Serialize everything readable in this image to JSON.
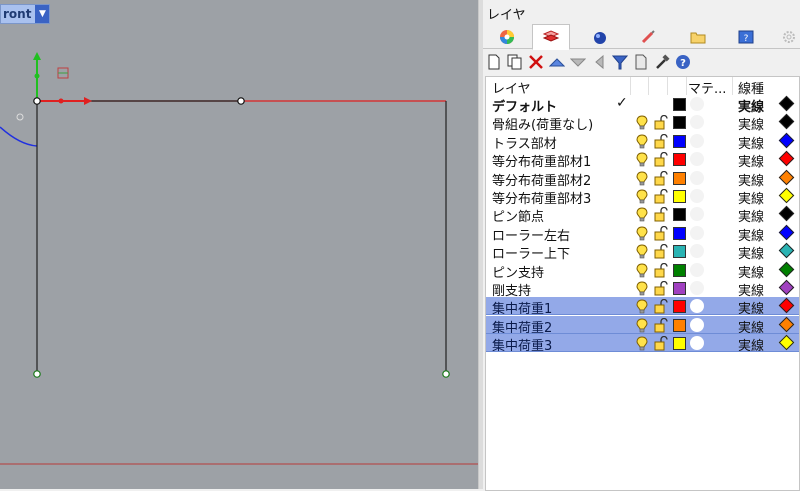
{
  "viewport": {
    "name": "ront",
    "dropdown_glyph": "▼"
  },
  "panel": {
    "title": "レイヤ",
    "tabs": [
      {
        "icon": "color-wheel-icon"
      },
      {
        "icon": "layers-icon",
        "active": true
      },
      {
        "icon": "render-sphere-icon"
      },
      {
        "icon": "brush-icon"
      },
      {
        "icon": "folder-icon"
      },
      {
        "icon": "help-window-icon"
      },
      {
        "icon": "gear-icon"
      }
    ],
    "toolbar": [
      {
        "icon": "new-layer-icon"
      },
      {
        "icon": "new-sublayer-icon"
      },
      {
        "icon": "delete-icon"
      },
      {
        "icon": "move-up-icon"
      },
      {
        "icon": "move-down-icon"
      },
      {
        "icon": "move-left-icon"
      },
      {
        "icon": "filter-icon"
      },
      {
        "icon": "document-icon"
      },
      {
        "icon": "tools-icon"
      },
      {
        "icon": "help-icon"
      }
    ]
  },
  "columns": {
    "layer": "レイヤ",
    "material": "マテ...",
    "linetype": "線種"
  },
  "layers": [
    {
      "name": "デフォルト",
      "current": true,
      "color": "#000000",
      "linetype": "実線",
      "bold": true
    },
    {
      "name": "骨組み(荷重なし)",
      "color": "#000000",
      "linetype": "実線"
    },
    {
      "name": "トラス部材",
      "color": "#0000ff",
      "linetype": "実線"
    },
    {
      "name": "等分布荷重部材1",
      "color": "#ff0000",
      "linetype": "実線"
    },
    {
      "name": "等分布荷重部材2",
      "color": "#ff8000",
      "linetype": "実線"
    },
    {
      "name": "等分布荷重部材3",
      "color": "#ffff00",
      "linetype": "実線"
    },
    {
      "name": "ピン節点",
      "color": "#000000",
      "linetype": "実線"
    },
    {
      "name": "ローラー左右",
      "color": "#0000ff",
      "linetype": "実線"
    },
    {
      "name": "ローラー上下",
      "color": "#2ab3b3",
      "linetype": "実線"
    },
    {
      "name": "ピン支持",
      "color": "#008000",
      "linetype": "実線"
    },
    {
      "name": "剛支持",
      "color": "#a040c0",
      "linetype": "実線"
    },
    {
      "name": "集中荷重1",
      "color": "#ff0000",
      "linetype": "実線",
      "selected": true
    },
    {
      "name": "集中荷重2",
      "color": "#ff8000",
      "linetype": "実線",
      "selected": true
    },
    {
      "name": "集中荷重3",
      "color": "#ffff00",
      "linetype": "実線",
      "selected": true
    }
  ],
  "icons": {
    "check": "✓"
  }
}
